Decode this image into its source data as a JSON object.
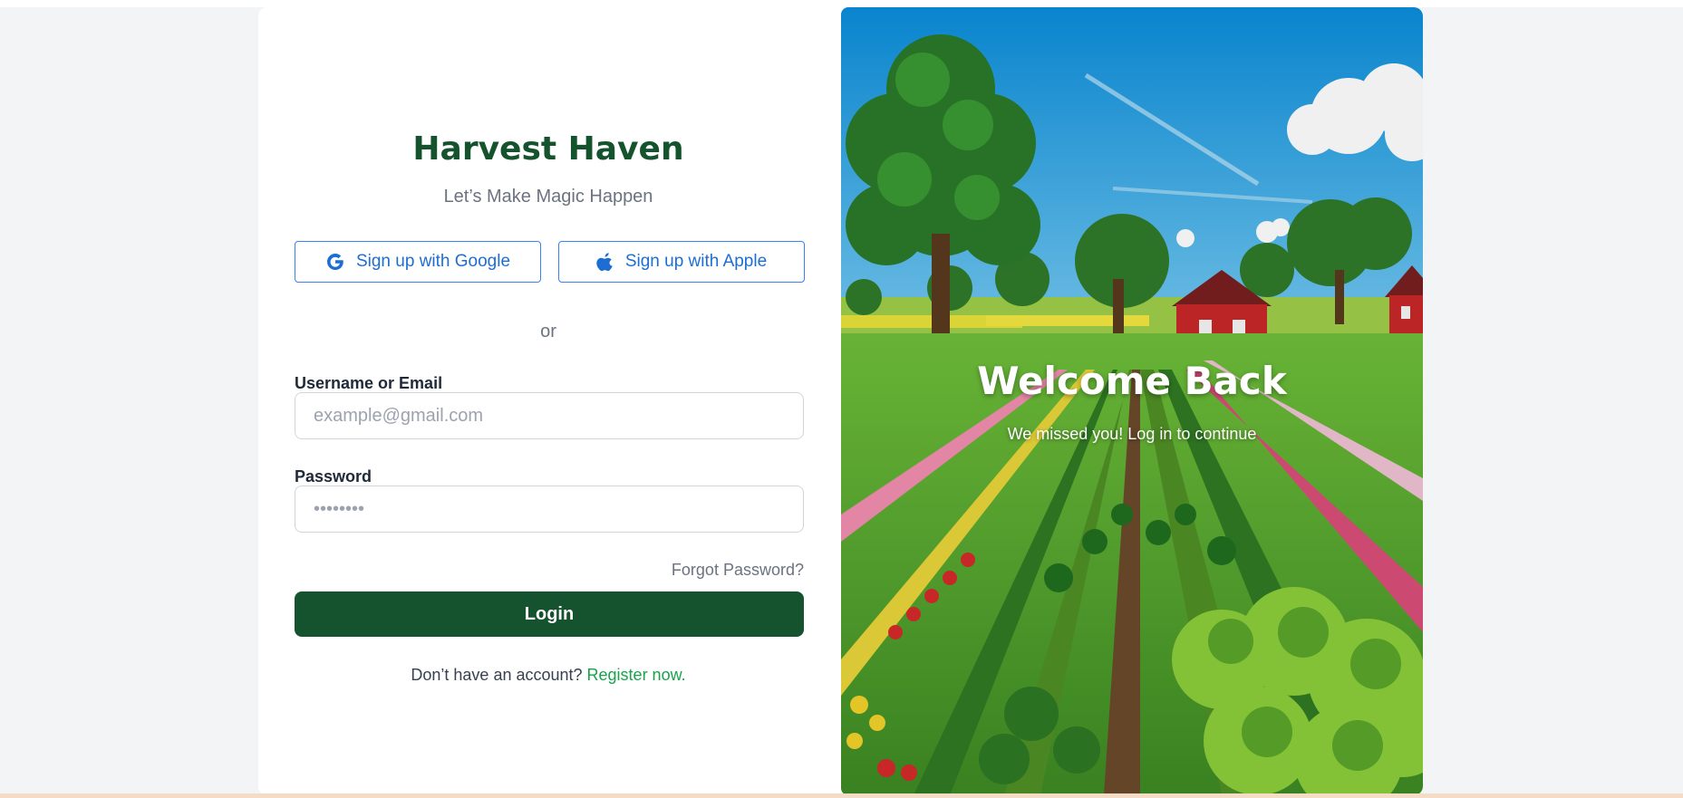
{
  "brand": {
    "title": "Harvest Haven",
    "subtitle": "Let’s Make Magic Happen"
  },
  "social": {
    "google_label": "Sign up with Google",
    "google_icon": "google-icon",
    "apple_label": "Sign up with Apple",
    "apple_icon": "apple-icon"
  },
  "divider": {
    "or_text": "or"
  },
  "form": {
    "username_label": "Username or Email",
    "username_placeholder": "example@gmail.com",
    "username_value": "",
    "password_label": "Password",
    "password_placeholder": "••••••••",
    "password_value": "",
    "forgot_password": "Forgot Password?",
    "login_label": "Login"
  },
  "register": {
    "prompt": "Don’t have an account? ",
    "link_text": "Register now."
  },
  "hero": {
    "title": "Welcome Back",
    "subtitle": "We missed you! Log in to continue"
  },
  "colors": {
    "brand_green": "#14532d",
    "link_green": "#16a34a",
    "social_blue": "#1d6ed3",
    "page_background": "#f3f4f6"
  }
}
